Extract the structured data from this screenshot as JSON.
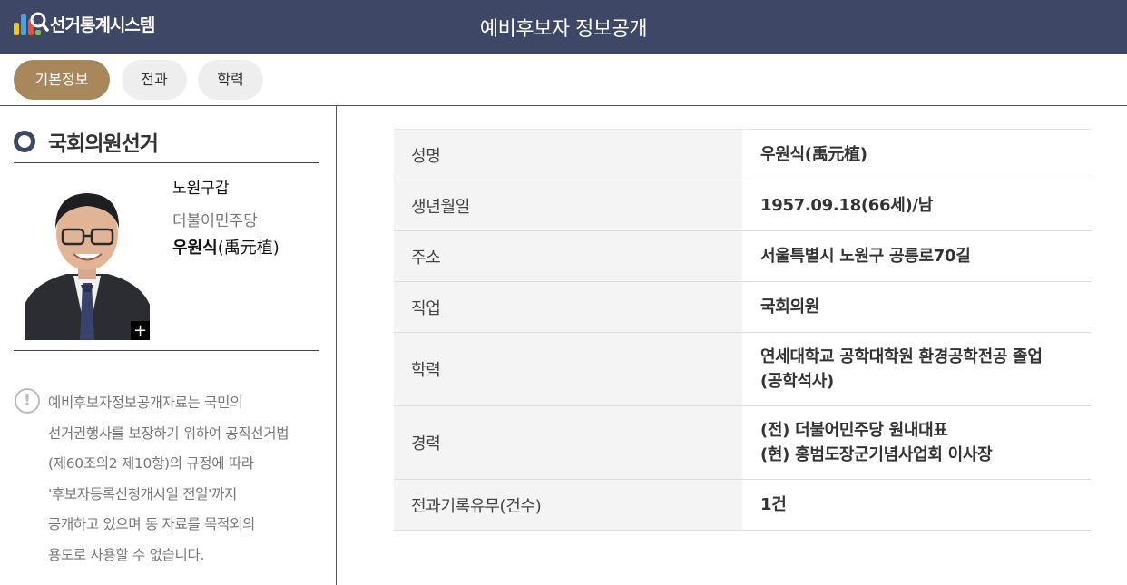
{
  "header": {
    "logo_text": "선거통계시스템",
    "title": "예비후보자 정보공개"
  },
  "tabs": [
    {
      "label": "기본정보",
      "active": true
    },
    {
      "label": "전과",
      "active": false
    },
    {
      "label": "학력",
      "active": false
    }
  ],
  "sidebar": {
    "section_title": "국회의원선거",
    "district": "노원구갑",
    "party": "더불어민주당",
    "name": "우원식",
    "name_hanja": "(禹元植)",
    "photo_expand_label": "+",
    "notice_lines": [
      "예비후보자정보공개자료는 국민의",
      "선거권행사를 보장하기 위하여 공직선거법",
      "(제60조의2 제10항)의 규정에 따라",
      "'후보자등록신청개시일 전일'까지",
      "공개하고 있으며 동 자료를 목적외의",
      "용도로 사용할 수 없습니다."
    ]
  },
  "info_rows": [
    {
      "label": "성명",
      "lines": [
        "우원식(禹元植)"
      ]
    },
    {
      "label": "생년월일",
      "lines": [
        "1957.09.18(66세)/남"
      ]
    },
    {
      "label": "주소",
      "lines": [
        "서울특별시 노원구 공릉로70길"
      ]
    },
    {
      "label": "직업",
      "lines": [
        "국회의원"
      ]
    },
    {
      "label": "학력",
      "lines": [
        "연세대학교 공학대학원 환경공학전공 졸업",
        "(공학석사)"
      ]
    },
    {
      "label": "경력",
      "lines": [
        "(전) 더불어민주당 원내대표",
        "(현) 홍범도장군기념사업회 이사장"
      ]
    },
    {
      "label": "전과기록유무(건수)",
      "lines": [
        "1건"
      ]
    }
  ],
  "colors": {
    "header_bg": "#3e4866",
    "tab_active": "#a8875a",
    "tab_inactive": "#eeeeee",
    "label_cell_bg": "#f4f4f4"
  },
  "icons": [
    "logo-bars-magnifier-icon",
    "ring-bullet-icon",
    "exclamation-circle-icon",
    "plus-icon"
  ]
}
